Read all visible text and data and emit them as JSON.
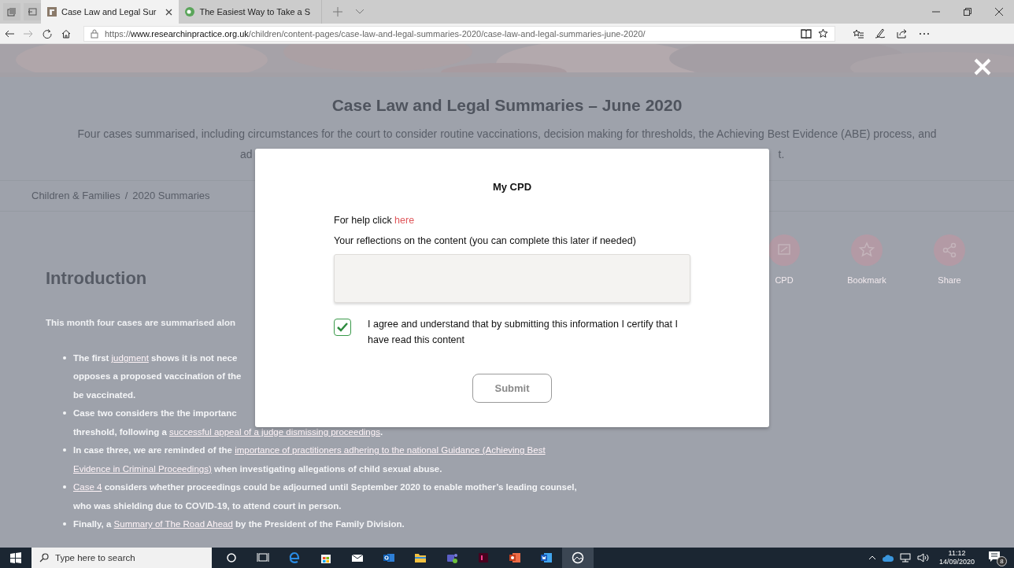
{
  "browser": {
    "tabs": [
      {
        "title": "Case Law and Legal Sur",
        "selected": true
      },
      {
        "title": "The Easiest Way to Take a S",
        "selected": false
      }
    ],
    "url": {
      "scheme": "https://",
      "domain": "www.researchinpractice.org.uk",
      "path": "/children/content-pages/case-law-and-legal-summaries-2020/case-law-and-legal-summaries-june-2020/"
    }
  },
  "page": {
    "title": "Case Law and Legal Summaries – June 2020",
    "subtitle_line_1": "Four cases summarised, including circumstances for the court to consider routine vaccinations, decision making for thresholds, the Achieving Best Evidence (ABE) process, and",
    "subtitle_line_2": [
      "ad",
      "t."
    ],
    "breadcrumb": [
      {
        "label": "Children & Families"
      },
      {
        "label": "2020 Summaries"
      }
    ],
    "breadcrumb_separator": "/",
    "heading": "Introduction",
    "intro": "This month four cases are summarised alon",
    "actions": [
      {
        "label": "CPD",
        "kind": "cpd"
      },
      {
        "label": "Bookmark",
        "kind": "bookmark"
      },
      {
        "label": "Share",
        "kind": "share"
      }
    ],
    "bullets": [
      {
        "lines": [
          [
            {
              "text": "The first "
            },
            {
              "text": "judgment",
              "link": true
            },
            {
              "text": " shows it is not nece"
            }
          ],
          [
            {
              "text": "opposes a proposed vaccination of the"
            }
          ],
          [
            {
              "text": "be vaccinated."
            }
          ]
        ]
      },
      {
        "lines": [
          [
            {
              "text": "Case two considers the the importanc"
            }
          ],
          [
            {
              "text": "threshold, following a "
            },
            {
              "text": "successful appeal of a judge dismissing proceedings",
              "link": true
            },
            {
              "text": "."
            }
          ]
        ]
      },
      {
        "lines": [
          [
            {
              "text": "In case three, we are reminded of the "
            },
            {
              "text": "importance of practitioners adhering to the national Guidance (Achieving Best",
              "link": true
            }
          ],
          [
            {
              "text": "Evidence in Criminal Proceedings)",
              "link": true
            },
            {
              "text": " when investigating allegations of child sexual abuse."
            }
          ]
        ]
      },
      {
        "lines": [
          [
            {
              "text": "Case 4",
              "link": true
            },
            {
              "text": " considers whether proceedings could be adjourned until September 2020 to enable mother’s leading counsel,"
            }
          ],
          [
            {
              "text": "who was shielding due to COVID-19, to attend court in person."
            }
          ]
        ]
      },
      {
        "lines": [
          [
            {
              "text": "Finally, a "
            },
            {
              "text": "Summary of The Road Ahead",
              "link": true
            },
            {
              "text": " by the President of the Family Division."
            }
          ]
        ]
      }
    ]
  },
  "modal": {
    "title": "My CPD",
    "help_text": "For help click",
    "help_link": "here",
    "reflections_label": "Your reflections on the content (you can complete this later if needed)",
    "agree": {
      "checked": true,
      "text": "I agree and understand that by submitting this information I certify that I have read this content"
    },
    "submit": "Submit"
  },
  "taskbar": {
    "search_placeholder": "Type here to search",
    "time": "11:12",
    "date": "14/09/2020",
    "notification_count": "8"
  }
}
